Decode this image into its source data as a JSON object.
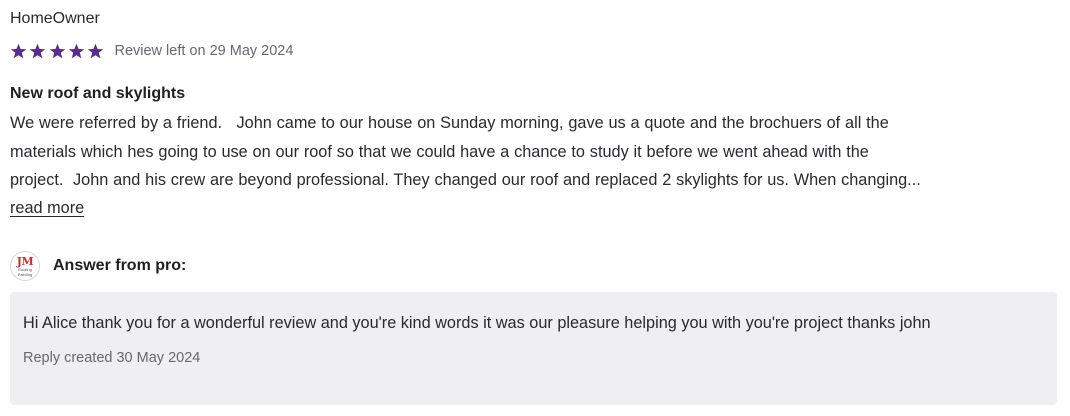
{
  "review": {
    "reviewer_name": "HomeOwner",
    "rating": 5,
    "rating_max": 5,
    "star_color": "#5a2d8c",
    "date_text": "Review left on 29 May 2024",
    "title": "New roof and skylights",
    "body_lines": [
      "We were referred by a friend.   John came to our house on Sunday morning, gave us a quote and the brochuers of all the",
      "materials which hes going to use on our roof so that we could have a chance to study it before we went ahead with the",
      "project.  John and his crew are beyond professional. They changed our roof and replaced 2 skylights for us. When changing..."
    ],
    "read_more_label": "read more"
  },
  "pro_answer": {
    "logo_text": "JM",
    "logo_subtext": "Roofing Painting",
    "label": "Answer from pro:",
    "reply_text": "Hi Alice thank you for a wonderful review and you're kind words it was our pleasure helping you with you're project thanks john",
    "reply_date": "Reply created 30 May 2024"
  }
}
